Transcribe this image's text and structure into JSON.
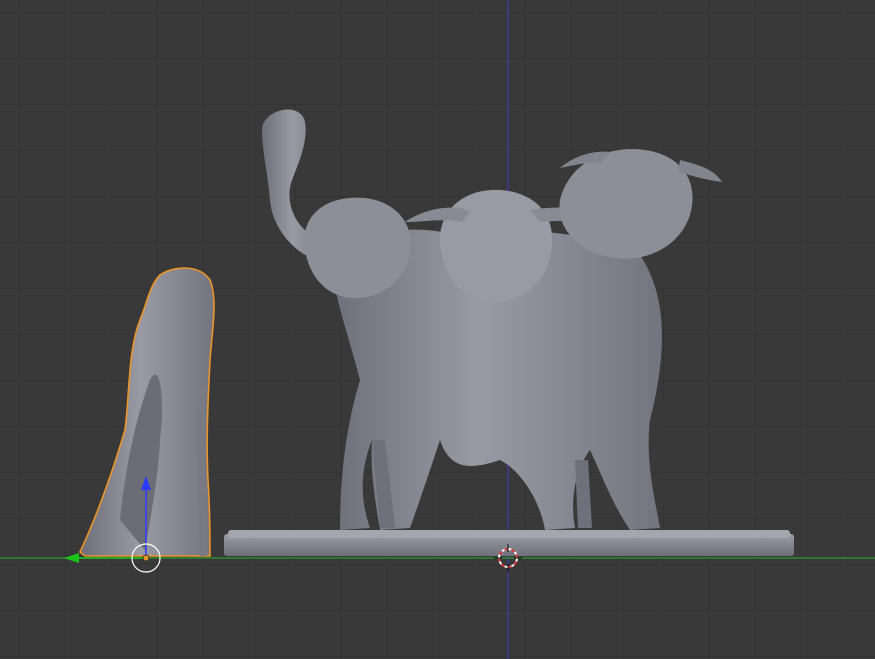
{
  "viewport": {
    "background_color": "#393939",
    "grid_color": "#2f2f2f",
    "axis_x_color": "#2e8b2e",
    "axis_z_color": "#3d3f8f",
    "selection_outline_color": "#e8962a",
    "mesh_color": "#8b8b94"
  },
  "objects": [
    {
      "name": "hooded-figure-miniature",
      "selected": true
    },
    {
      "name": "three-headed-dog-miniature",
      "selected": false
    }
  ],
  "gizmo": {
    "x_axis_color": "#19c619",
    "z_axis_color": "#2a3cff",
    "origin_color": "#e8962a"
  },
  "cursor_3d": {
    "ring_colors": [
      "#d33b3b",
      "#ffffff"
    ]
  }
}
